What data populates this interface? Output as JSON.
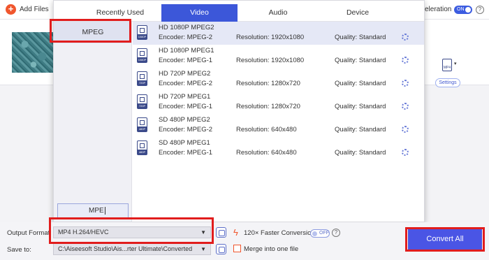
{
  "topbar": {
    "add_files_label": "Add Files",
    "acceleration_label": "cceleration",
    "accel_toggle": "ON",
    "help_glyph": "?"
  },
  "file_row": {
    "format_icon_label": "MP4",
    "settings_label": "Settings"
  },
  "panel": {
    "tabs": [
      {
        "label": "Recently Used",
        "active": false
      },
      {
        "label": "Video",
        "active": true
      },
      {
        "label": "Audio",
        "active": false
      },
      {
        "label": "Device",
        "active": false
      }
    ],
    "sidebar": {
      "selected_item": "MPEG",
      "search_value": "MPE"
    },
    "formats": [
      {
        "name": "HD 1080P MPEG2",
        "encoder": "Encoder: MPEG-2",
        "resolution": "Resolution: 1920x1080",
        "quality": "Quality: Standard",
        "badge": "1080P",
        "selected": true
      },
      {
        "name": "HD 1080P MPEG1",
        "encoder": "Encoder: MPEG-1",
        "resolution": "Resolution: 1920x1080",
        "quality": "Quality: Standard",
        "badge": "1080P",
        "selected": false
      },
      {
        "name": "HD 720P MPEG2",
        "encoder": "Encoder: MPEG-2",
        "resolution": "Resolution: 1280x720",
        "quality": "Quality: Standard",
        "badge": "720P",
        "selected": false
      },
      {
        "name": "HD 720P MPEG1",
        "encoder": "Encoder: MPEG-1",
        "resolution": "Resolution: 1280x720",
        "quality": "Quality: Standard",
        "badge": "720P",
        "selected": false
      },
      {
        "name": "SD 480P MPEG2",
        "encoder": "Encoder: MPEG-2",
        "resolution": "Resolution: 640x480",
        "quality": "Quality: Standard",
        "badge": "480P",
        "selected": false
      },
      {
        "name": "SD 480P MPEG1",
        "encoder": "Encoder: MPEG-1",
        "resolution": "Resolution: 640x480",
        "quality": "Quality: Standard",
        "badge": "480P",
        "selected": false
      }
    ]
  },
  "bottom": {
    "output_format_label": "Output Format:",
    "output_format_value": "MP4 H.264/HEVC",
    "save_to_label": "Save to:",
    "save_to_value": "C:\\Aiseesoft Studio\\Ais...rter Ultimate\\Converted",
    "faster_label": "120× Faster Conversion",
    "faster_toggle": "OFF",
    "help_glyph": "?",
    "merge_label": "Merge into one file",
    "convert_all_label": "Convert All"
  },
  "colors": {
    "accent": "#3c57d9",
    "highlight": "#e11d1d",
    "orange": "#f0562d",
    "convert": "#4a55e5"
  }
}
